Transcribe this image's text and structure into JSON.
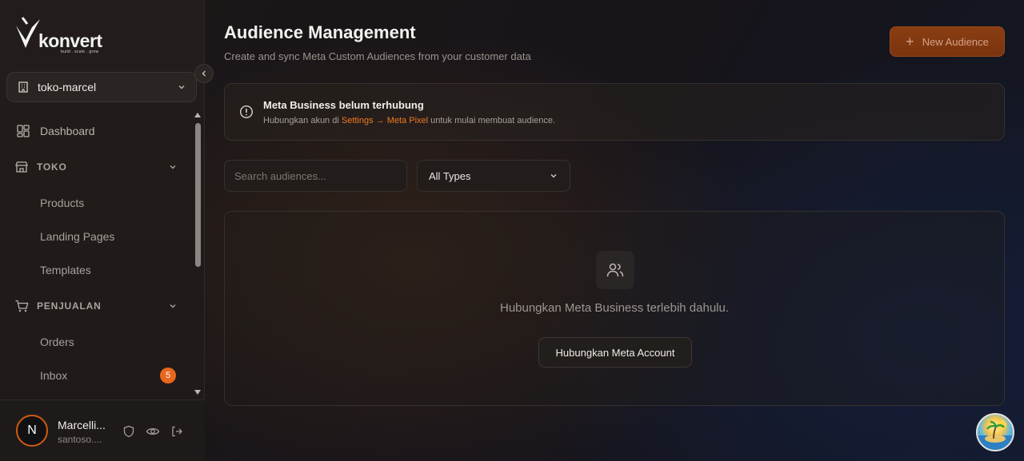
{
  "brand": {
    "name": "konvert",
    "tagline": "build . scale . grow"
  },
  "store_selector": {
    "value": "toko-marcel"
  },
  "sidebar": {
    "dashboard": "Dashboard",
    "sections": [
      {
        "label": "TOKO",
        "items": [
          "Products",
          "Landing Pages",
          "Templates"
        ]
      },
      {
        "label": "PENJUALAN",
        "items": [
          "Orders",
          "Inbox"
        ]
      }
    ],
    "inbox_badge": "5"
  },
  "user": {
    "initial": "N",
    "name": "Marcelli...",
    "email": "santoso...."
  },
  "header": {
    "title": "Audience Management",
    "subtitle": "Create and sync Meta Custom Audiences from your customer data",
    "new_button": "New Audience"
  },
  "alert": {
    "title": "Meta Business belum terhubung",
    "desc_prefix": "Hubungkan akun di ",
    "link": "Settings → Meta Pixel",
    "desc_suffix": " untuk mulai membuat audience."
  },
  "filters": {
    "search_placeholder": "Search audiences...",
    "type_value": "All Types"
  },
  "empty_state": {
    "message": "Hubungkan Meta Business terlebih dahulu.",
    "button": "Hubungkan Meta Account"
  },
  "colors": {
    "accent": "#e8671c",
    "link": "#ef7a22"
  }
}
